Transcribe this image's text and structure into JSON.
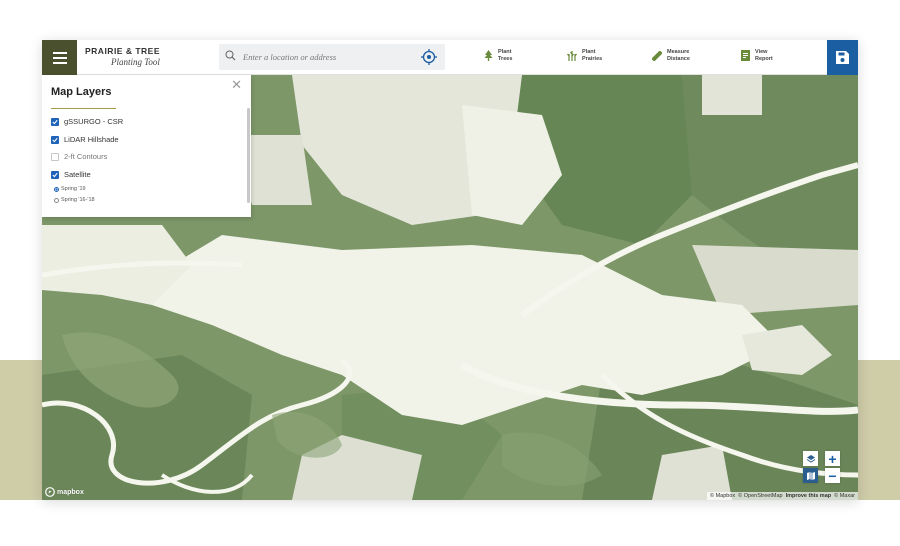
{
  "app": {
    "title_line1": "PRAIRIE & TREE",
    "title_line2": "Planting Tool"
  },
  "search": {
    "placeholder": "Enter a location or address"
  },
  "tools": [
    {
      "label1": "Plant",
      "label2": "Trees",
      "icon": "tree-icon"
    },
    {
      "label1": "Plant",
      "label2": "Prairies",
      "icon": "grass-icon"
    },
    {
      "label1": "Measure",
      "label2": "Distance",
      "icon": "ruler-icon"
    },
    {
      "label1": "View",
      "label2": "Report",
      "icon": "report-icon"
    }
  ],
  "save": {
    "icon": "save-icon"
  },
  "layers_panel": {
    "title": "Map Layers",
    "items": [
      {
        "label": "gSSURGO - CSR",
        "checked": true
      },
      {
        "label": "LiDAR Hillshade",
        "checked": true
      },
      {
        "label": "2-ft Contours",
        "checked": false
      },
      {
        "label": "Satellite",
        "checked": true
      }
    ],
    "radios": [
      {
        "label": "Spring '19",
        "selected": true
      },
      {
        "label": "Spring '16-'18",
        "selected": false
      }
    ]
  },
  "map": {
    "logo": "mapbox",
    "attribution": {
      "mapbox": "© Mapbox",
      "osm": "© OpenStreetMap",
      "improve": "Improve this map",
      "maxar": "© Maxar"
    }
  },
  "colors": {
    "brand_dark": "#4a4f2e",
    "save_blue": "#1b5ea1",
    "forest_green": "#6e8b5c",
    "valley_cream": "#f1f2e8",
    "accent_gold": "#a59b4a"
  }
}
